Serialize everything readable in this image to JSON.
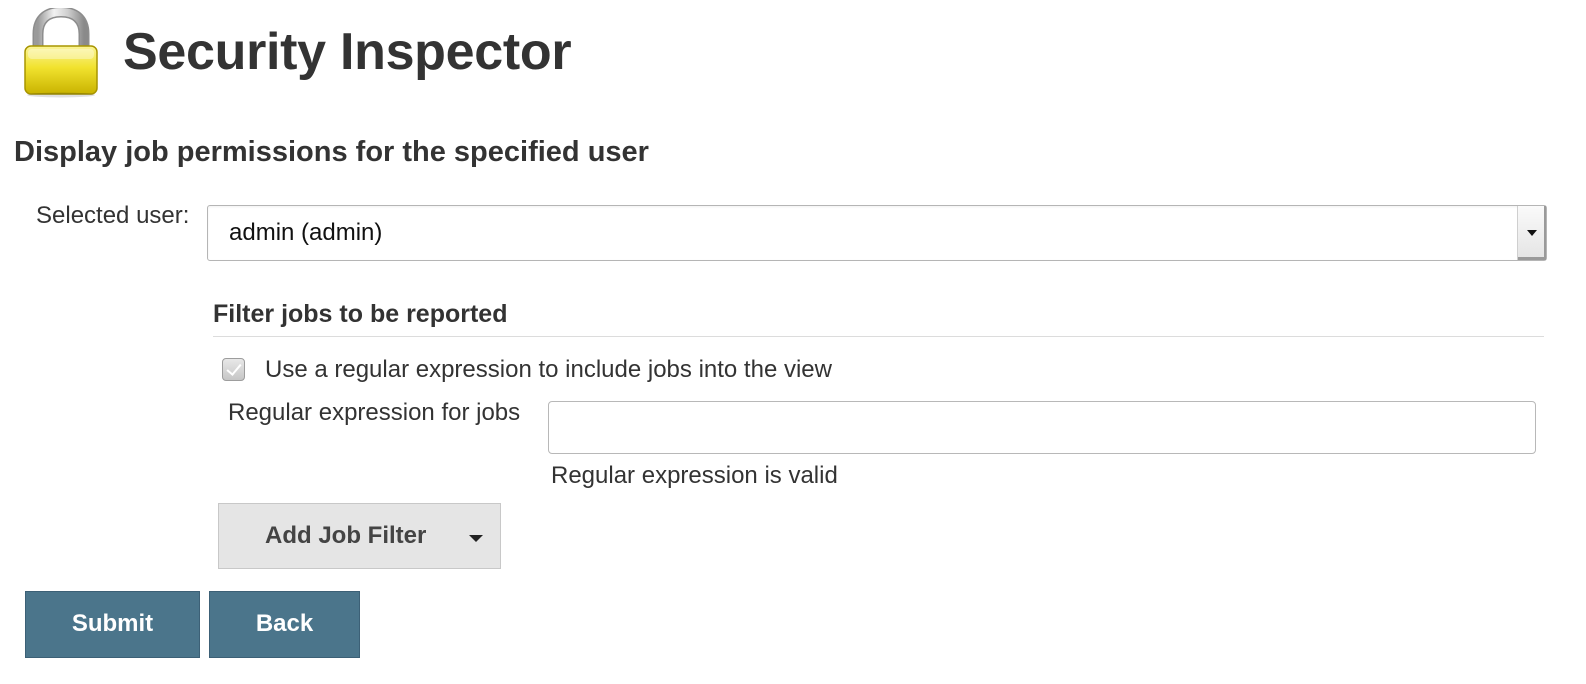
{
  "header": {
    "title": "Security Inspector",
    "icon": "lock-icon"
  },
  "section": {
    "heading": "Display job permissions for the specified user"
  },
  "user_select": {
    "label": "Selected user:",
    "value": "admin (admin)"
  },
  "filter": {
    "heading": "Filter jobs to be reported",
    "regex_checkbox": {
      "label": "Use a regular expression to include jobs into the view",
      "checked": true
    },
    "regex_field": {
      "label": "Regular expression for jobs",
      "value": ""
    },
    "validation_message": "Regular expression is valid",
    "add_filter_label": "Add Job Filter"
  },
  "actions": {
    "submit_label": "Submit",
    "back_label": "Back"
  },
  "colors": {
    "primary_button": "#4b758b",
    "lock_yellow": "#f3e33a"
  }
}
